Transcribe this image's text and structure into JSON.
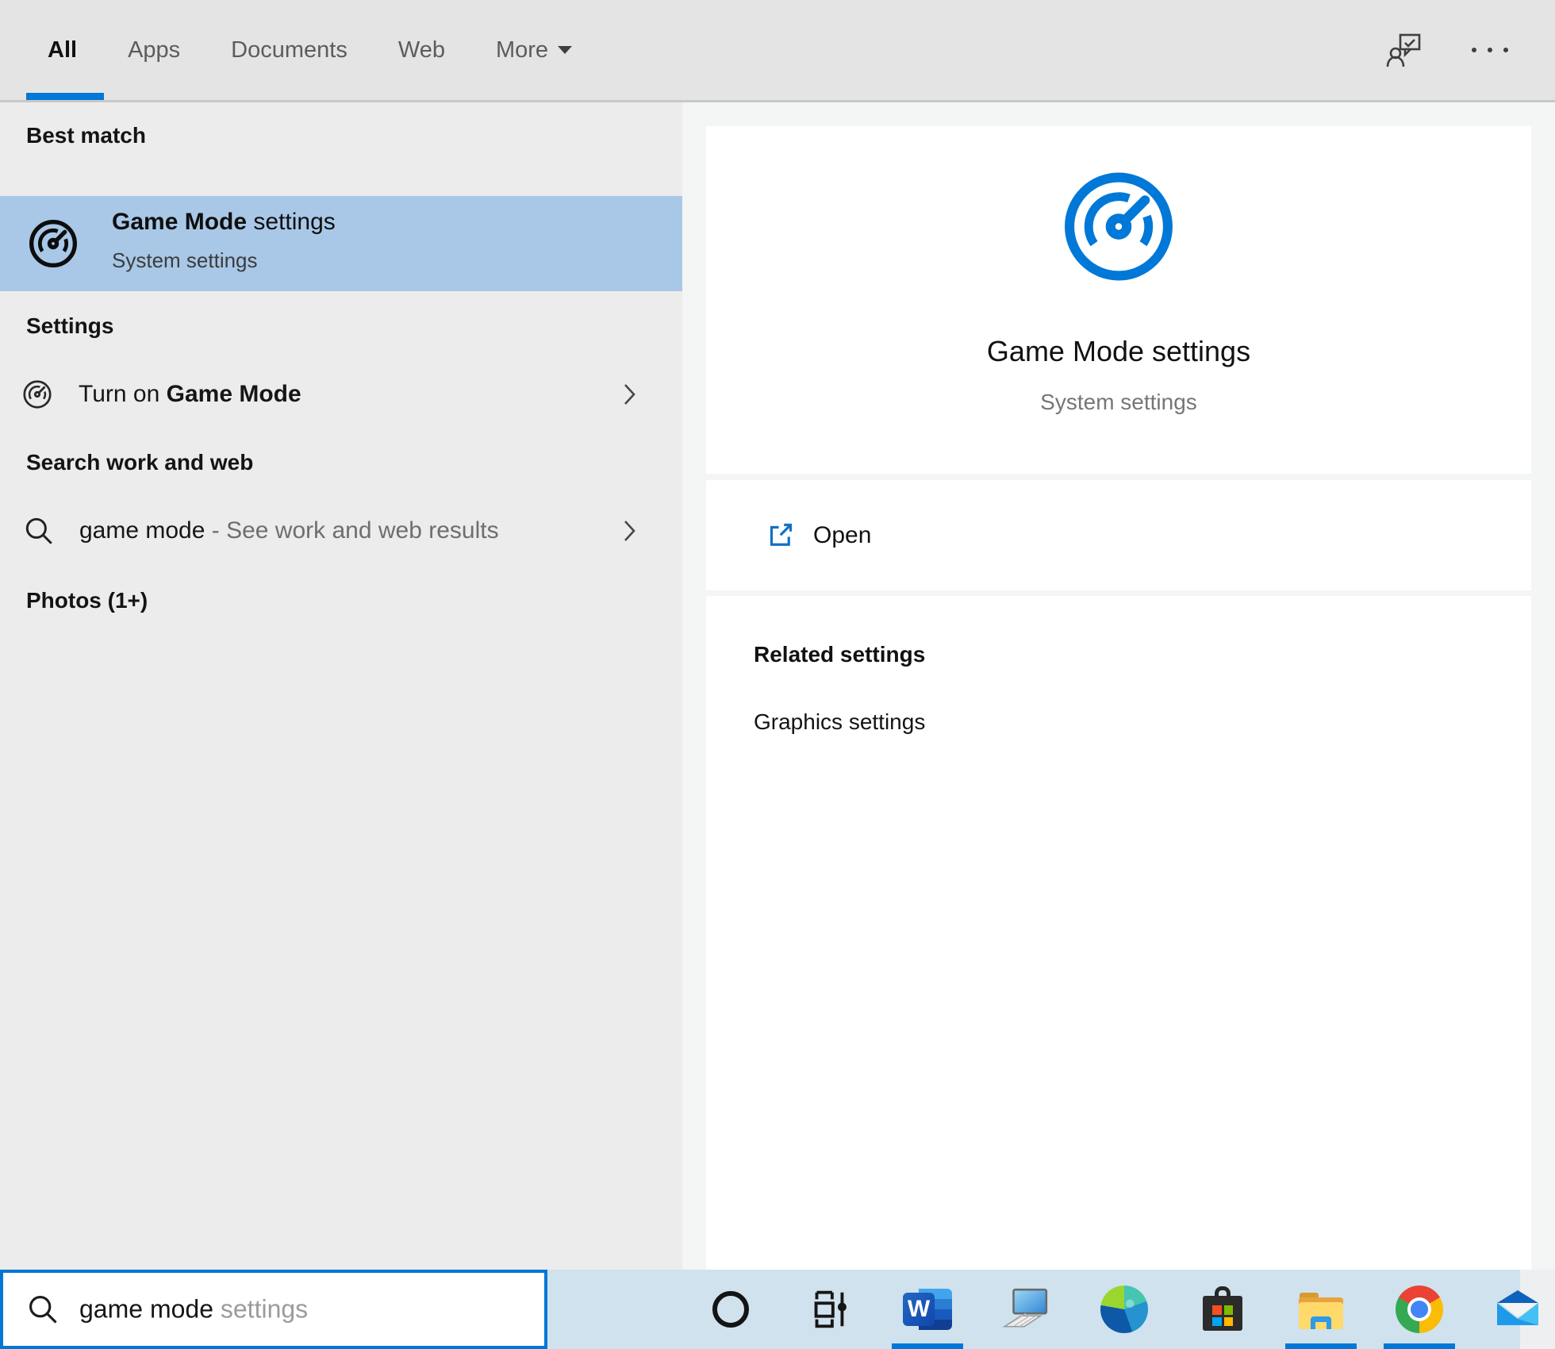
{
  "colors": {
    "accent": "#0078d7",
    "best_match_highlight": "#a9c8e8",
    "tabbar_bg": "#e4e4e4",
    "left_panel_bg": "#ececec",
    "right_pane_bg": "#f4f5f5",
    "taskbar_bg": "#d0e2ee",
    "searchbox_border": "#0077d4"
  },
  "tabs": [
    {
      "label": "All",
      "active": true
    },
    {
      "label": "Apps",
      "active": false
    },
    {
      "label": "Documents",
      "active": false
    },
    {
      "label": "Web",
      "active": false
    },
    {
      "label": "More",
      "active": false,
      "has_dropdown": true
    }
  ],
  "topbar_icons": {
    "feedback": "person-feedback-icon",
    "options": "ellipsis-icon"
  },
  "left_panel": {
    "best_match": {
      "header": "Best match",
      "item": {
        "title_bold": "Game Mode",
        "title_rest": " settings",
        "subtitle": "System settings",
        "icon": "gauge-icon"
      }
    },
    "settings_section": {
      "header": "Settings",
      "item": {
        "prefix": "Turn on ",
        "bold": "Game Mode",
        "icon": "gauge-icon"
      }
    },
    "web_section": {
      "header": "Search work and web",
      "item": {
        "query": "game mode",
        "rest": " - See work and web results",
        "icon": "search-icon"
      }
    },
    "photos_section": {
      "header": "Photos (1+)"
    }
  },
  "preview": {
    "icon": "gauge-icon",
    "title": "Game Mode settings",
    "subtitle": "System settings",
    "open_label": "Open",
    "open_icon": "open-external-icon",
    "related_header": "Related settings",
    "related_link": "Graphics settings"
  },
  "searchbox": {
    "typed": "game mode",
    "suggestion": " settings",
    "icon": "search-icon"
  },
  "taskbar": {
    "buttons": [
      {
        "name": "cortana",
        "running": false
      },
      {
        "name": "task-view",
        "running": false
      },
      {
        "name": "word",
        "running": true
      },
      {
        "name": "this-pc",
        "running": false
      },
      {
        "name": "edge",
        "running": false
      },
      {
        "name": "microsoft-store",
        "running": false
      },
      {
        "name": "file-explorer",
        "running": true
      },
      {
        "name": "chrome",
        "running": true
      },
      {
        "name": "mail",
        "running": false
      }
    ]
  }
}
